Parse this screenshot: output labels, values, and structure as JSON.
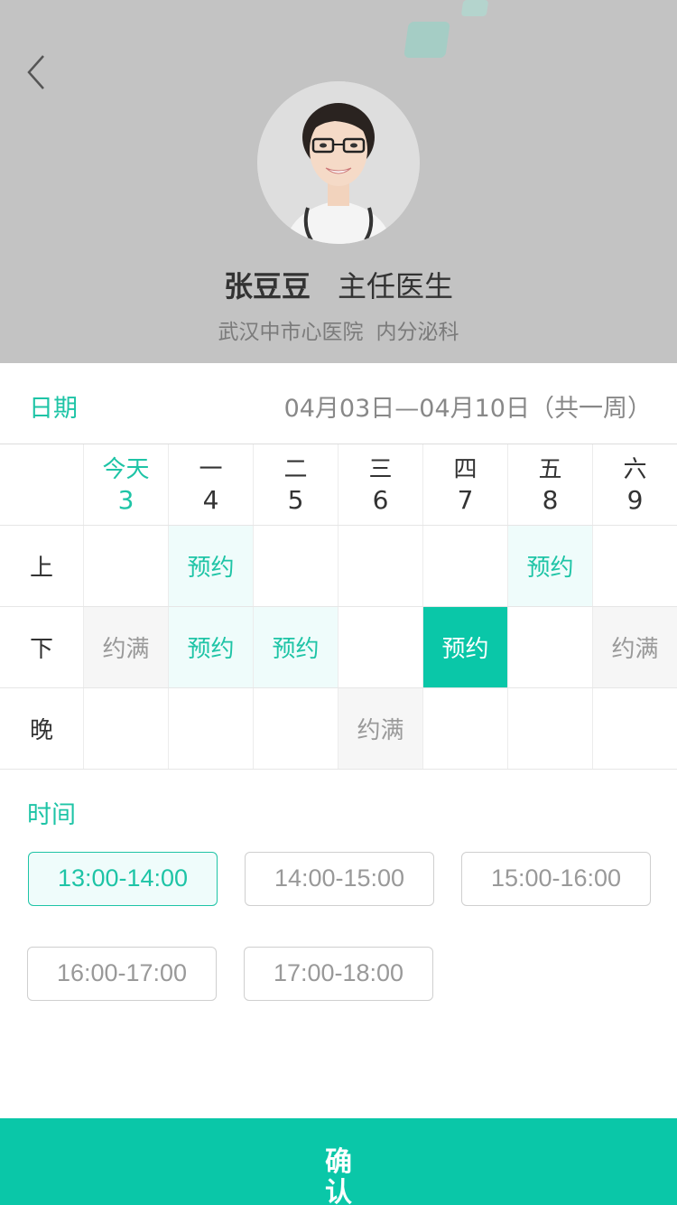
{
  "header": {
    "doctor_name": "张豆豆",
    "doctor_title": "主任医生",
    "hospital": "武汉中市心医院",
    "department": "内分泌科"
  },
  "date_row": {
    "label": "日期",
    "range": "04月03日—04月10日（共一周）"
  },
  "schedule": {
    "days": [
      {
        "weekday": "今天",
        "date": "3",
        "today": true
      },
      {
        "weekday": "一",
        "date": "4"
      },
      {
        "weekday": "二",
        "date": "5"
      },
      {
        "weekday": "三",
        "date": "6"
      },
      {
        "weekday": "四",
        "date": "7"
      },
      {
        "weekday": "五",
        "date": "8"
      },
      {
        "weekday": "六",
        "date": "9"
      }
    ],
    "periods": [
      {
        "label": "上",
        "cells": [
          "",
          "预约",
          "",
          "",
          "",
          "预约",
          ""
        ]
      },
      {
        "label": "下",
        "cells": [
          "约满",
          "预约",
          "预约",
          "",
          "预约",
          "",
          "约满"
        ]
      },
      {
        "label": "晚",
        "cells": [
          "",
          "",
          "",
          "约满",
          "",
          "",
          ""
        ]
      }
    ],
    "selected": {
      "period": 1,
      "day": 4
    },
    "available_label": "预约",
    "full_label": "约满"
  },
  "time": {
    "label": "时间",
    "slots": [
      "13:00-14:00",
      "14:00-15:00",
      "15:00-16:00",
      "16:00-17:00",
      "17:00-18:00"
    ],
    "selected_index": 0
  },
  "confirm_label": "确认",
  "colors": {
    "accent": "#0ac7a8",
    "accent_light": "#effcfb",
    "header_bg": "#c3c3c3",
    "full_bg": "#f6f6f6"
  }
}
